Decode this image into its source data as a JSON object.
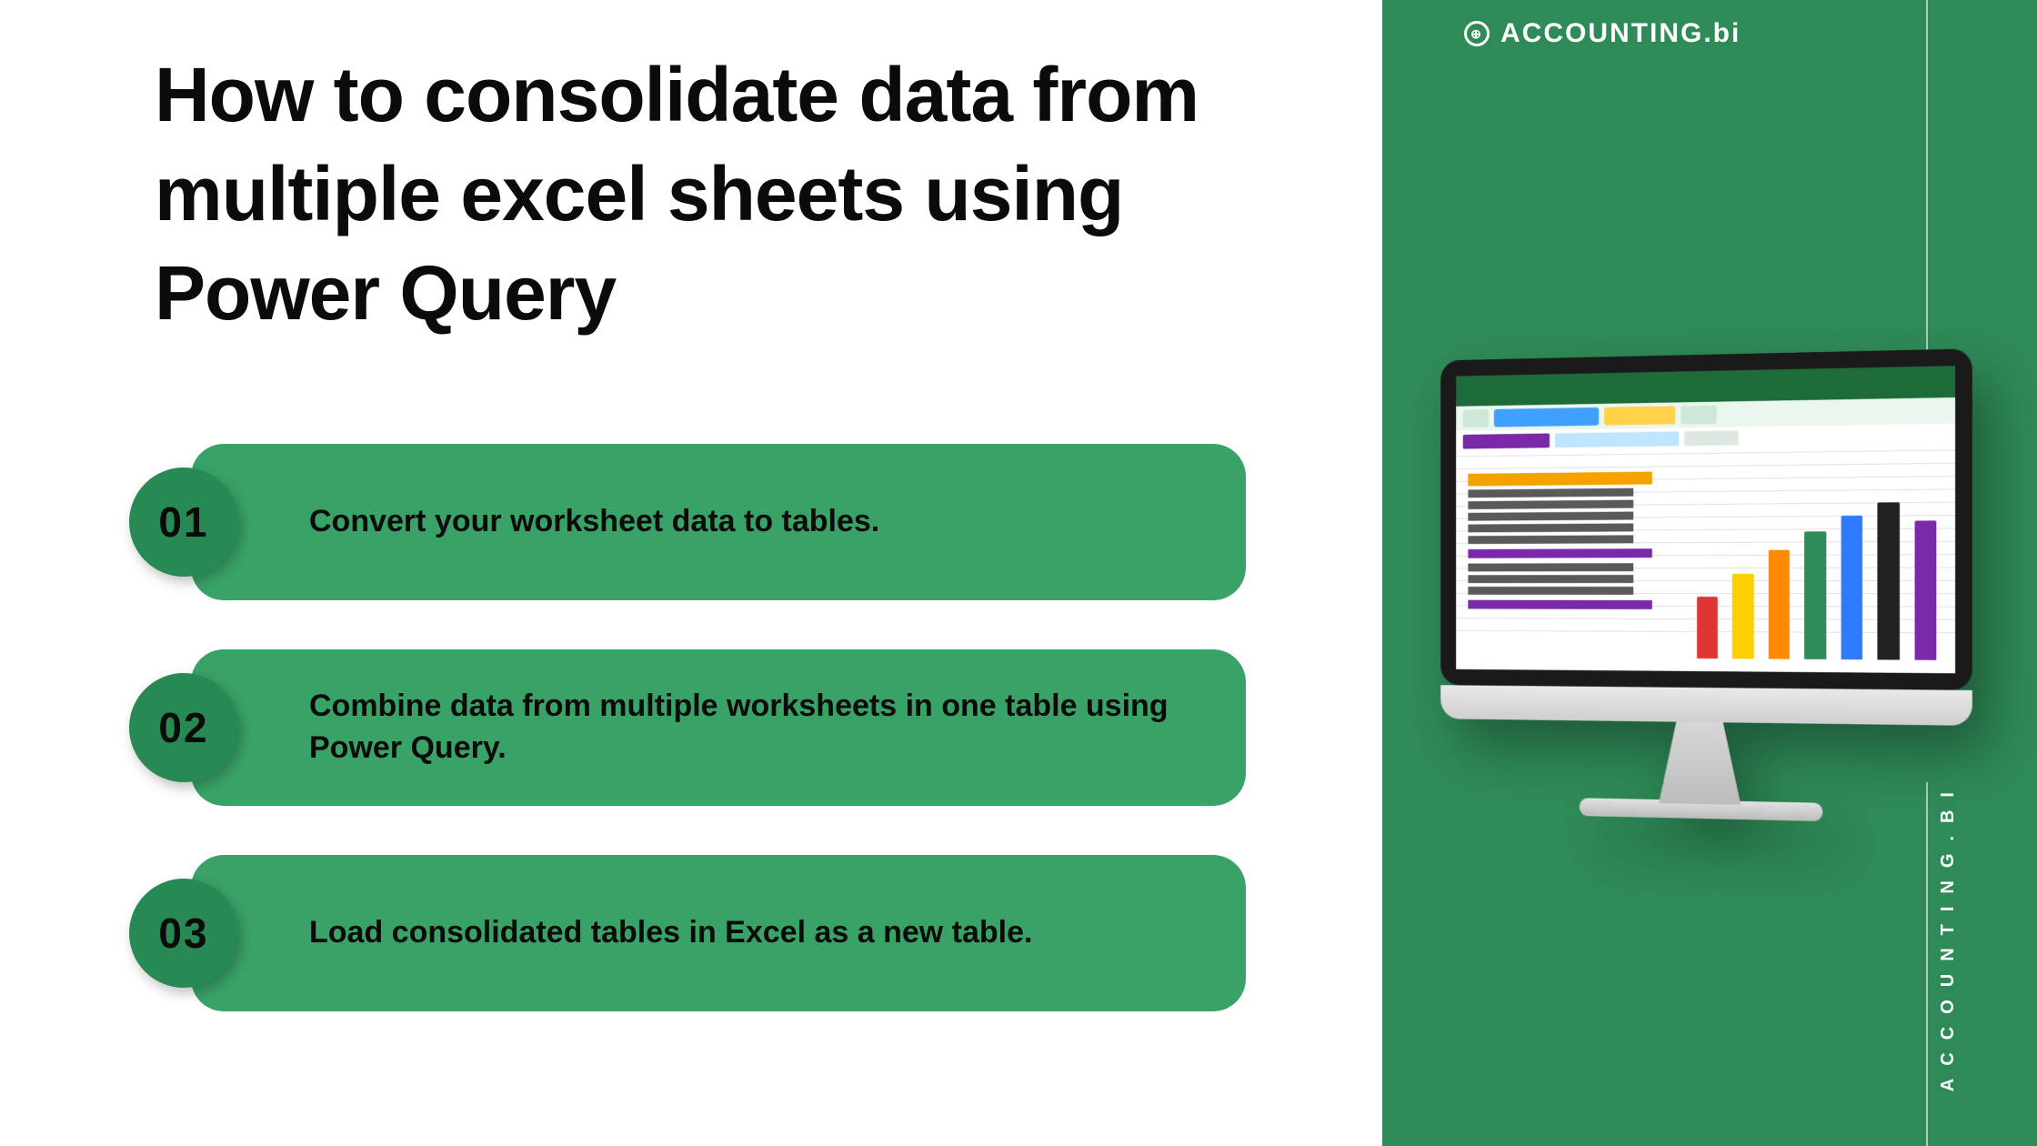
{
  "title": "How to consolidate data from multiple excel sheets using Power Query",
  "steps": [
    {
      "num": "01",
      "text": "Convert your worksheet data to tables."
    },
    {
      "num": "02",
      "text": "Combine data from multiple worksheets in one table using Power Query."
    },
    {
      "num": "03",
      "text": "Load consolidated tables in Excel as a new table."
    }
  ],
  "brand": {
    "logo_text": "ACCOUNTING.bi",
    "vertical_text": "ACCOUNTING.BI"
  },
  "colors": {
    "accent": "#2e8b57",
    "pill": "#39a367",
    "badge": "#278a55"
  }
}
